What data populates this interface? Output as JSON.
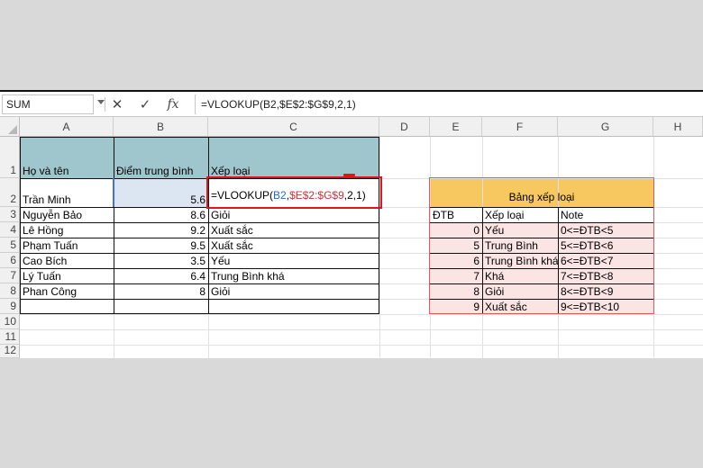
{
  "formula_bar": {
    "name_box": "SUM",
    "cancel_icon": "close-icon",
    "enter_icon": "check-icon",
    "fx_label": "fx",
    "formula": "=VLOOKUP(B2,$E$2:$G$9,2,1)"
  },
  "columns": [
    "A",
    "B",
    "C",
    "D",
    "E",
    "F",
    "G",
    "H"
  ],
  "rows": [
    "1",
    "2",
    "3",
    "4",
    "5",
    "6",
    "7",
    "8",
    "9",
    "10",
    "11",
    "12"
  ],
  "main_table": {
    "headers": [
      "Họ và tên",
      "Điểm trung bình",
      "Xếp loại"
    ],
    "data": [
      [
        "Trần Minh",
        "5.6"
      ],
      [
        "Nguyễn Bảo",
        "8.6",
        "Giỏi"
      ],
      [
        "Lê Hồng",
        "9.2",
        "Xuất sắc"
      ],
      [
        "Phạm Tuấn",
        "9.5",
        "Xuất sắc"
      ],
      [
        "Cao Bích",
        "3.5",
        "Yếu"
      ],
      [
        "Lý Tuấn",
        "6.4",
        "Trung Bình khá"
      ],
      [
        "Phan Công",
        "8",
        "Giỏi"
      ]
    ],
    "edit_formula": {
      "prefix": "=VLOOKUP(",
      "arg1": "B2",
      "sep1": ",",
      "arg2": "$E$2:$G$9",
      "rest": ",2,1)"
    }
  },
  "lookup_table": {
    "title": "Bảng xếp loại",
    "headers": [
      "ĐTB",
      "Xếp loại",
      "Note"
    ],
    "data": [
      [
        "0",
        "Yếu",
        "0<=ĐTB<5"
      ],
      [
        "5",
        "Trung Bình",
        "5<=ĐTB<6"
      ],
      [
        "6",
        "Trung Bình khá",
        "6<=ĐTB<7"
      ],
      [
        "7",
        "Khá",
        "7<=ĐTB<8"
      ],
      [
        "8",
        "Giỏi",
        "8<=ĐTB<9"
      ],
      [
        "9",
        "Xuất sắc",
        "9<=ĐTB<10"
      ]
    ]
  },
  "colors": {
    "header_fill": "#9fc5cd",
    "lookup_title_fill": "#f8c860",
    "lookup_body_fill": "#fbe4e4",
    "highlight_red": "#e0151b",
    "reference_blue": "#2c66c4",
    "reference_red": "#c8343c"
  }
}
